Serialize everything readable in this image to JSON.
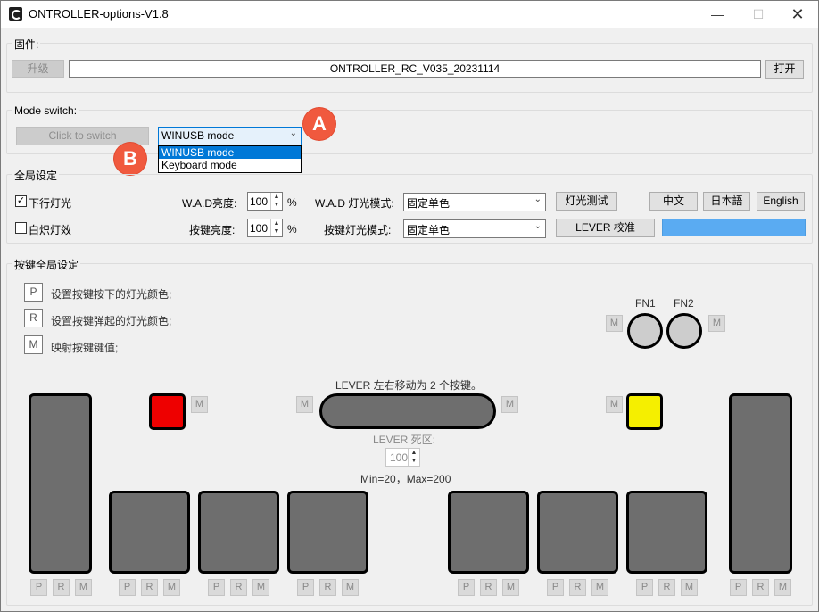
{
  "window": {
    "title": "ONTROLLER-options-V1.8",
    "controls": {
      "minimize": "—",
      "maximize": "☐",
      "close": "✕"
    }
  },
  "firmware": {
    "group_label": "固件:",
    "upgrade_label": "升级",
    "file_name": "ONTROLLER_RC_V035_20231114",
    "open_label": "打开"
  },
  "mode_switch": {
    "group_label": "Mode switch:",
    "switch_label": "Click to switch",
    "selected": "WINUSB mode",
    "options": [
      "WINUSB mode",
      "Keyboard mode"
    ],
    "badge_a": "A",
    "badge_b": "B"
  },
  "global": {
    "group_label": "全局设定",
    "down_light": {
      "label": "下行灯光",
      "checked": true,
      "mark": "✓"
    },
    "glow": {
      "label": "白炽灯效",
      "checked": false
    },
    "wad_brightness_label": "W.A.D亮度:",
    "wad_brightness_value": "100",
    "key_brightness_label": "按键亮度:",
    "key_brightness_value": "100",
    "percent": "%",
    "wad_mode_label": "W.A.D 灯光模式:",
    "wad_mode_value": "固定单色",
    "key_mode_label": "按键灯光模式:",
    "key_mode_value": "固定单色",
    "light_test_label": "灯光测试",
    "lever_calib_label": "LEVER 校准",
    "lang": [
      "中文",
      "日本語",
      "English"
    ],
    "color_swatch": "#5aabf2"
  },
  "keys": {
    "group_label": "按键全局设定",
    "legend": [
      {
        "letter": "P",
        "text": "设置按键按下的灯光颜色;"
      },
      {
        "letter": "R",
        "text": "设置按键弹起的灯光颜色;"
      },
      {
        "letter": "M",
        "text": "映射按键键值;"
      }
    ],
    "fn1": "FN1",
    "fn2": "FN2",
    "lever_note": "LEVER 左右移动为 2 个按键。",
    "deadzone_label": "LEVER 死区:",
    "deadzone_value": "100",
    "range_note": "Min=20，Max=200",
    "p": "P",
    "r": "R",
    "m": "M",
    "left_small_color": "#ee0000",
    "right_small_color": "#f5ef00"
  }
}
